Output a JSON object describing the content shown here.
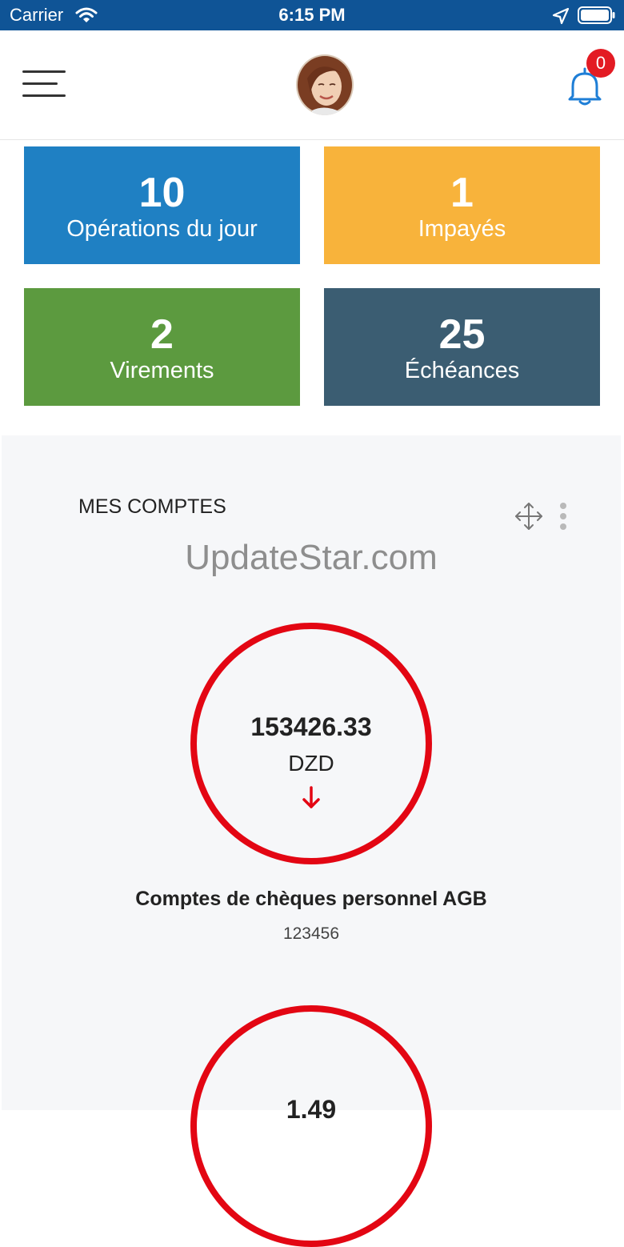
{
  "status_bar": {
    "carrier": "Carrier",
    "time": "6:15 PM",
    "icons": [
      "wifi-icon",
      "location-arrow-icon",
      "battery-icon"
    ]
  },
  "header": {
    "menu_icon": "hamburger-menu-icon",
    "avatar_icon": "user-avatar",
    "bell_icon": "bell-icon",
    "notification_count": "0"
  },
  "tiles": [
    {
      "value": "10",
      "label": "Opérations du jour",
      "color": "#1f80c3"
    },
    {
      "value": "1",
      "label": "Impayés",
      "color": "#f8b33b"
    },
    {
      "value": "2",
      "label": "Virements",
      "color": "#5c9a3f"
    },
    {
      "value": "25",
      "label": "Échéances",
      "color": "#3b5d72"
    }
  ],
  "accounts": {
    "title": "MES COMPTES",
    "watermark": "UpdateStar.com",
    "items": [
      {
        "balance": "153426.33",
        "currency": "DZD",
        "trend_icon": "arrow-down-icon",
        "name": "Comptes de chèques personnel AGB",
        "number": "123456"
      },
      {
        "balance": "1.49"
      }
    ]
  },
  "colors": {
    "status_bar": "#0f5496",
    "accent_blue": "#1e7ed6",
    "badge_red": "#e31b23",
    "circle_red": "#e30613"
  }
}
